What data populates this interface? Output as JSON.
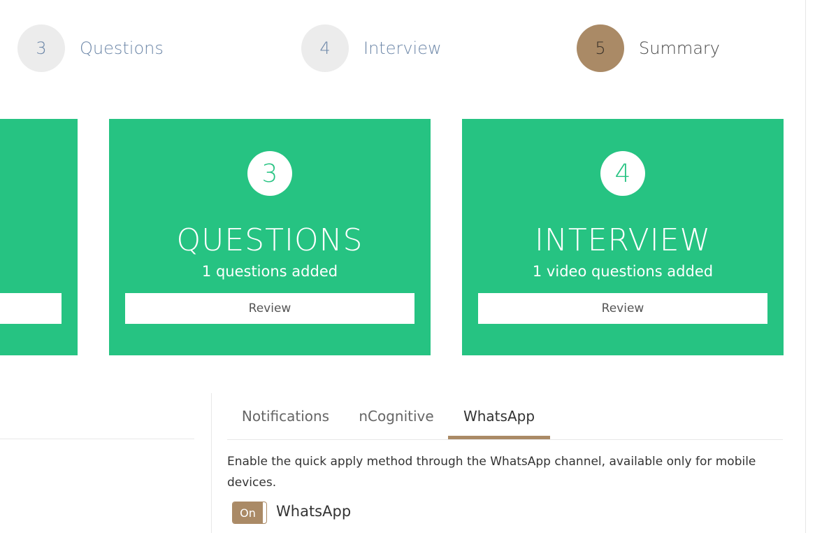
{
  "steps": [
    {
      "number": "3",
      "label": "Questions",
      "active": false
    },
    {
      "number": "4",
      "label": "Interview",
      "active": false
    },
    {
      "number": "5",
      "label": "Summary",
      "active": true
    }
  ],
  "cards": [
    {
      "number": "",
      "title": "",
      "subtitle": "",
      "button": ""
    },
    {
      "number": "3",
      "title": "QUESTIONS",
      "subtitle": "1 questions added",
      "button": "Review"
    },
    {
      "number": "4",
      "title": "INTERVIEW",
      "subtitle": "1 video questions added",
      "button": "Review"
    }
  ],
  "tabs": [
    {
      "label": "Notifications",
      "active": false
    },
    {
      "label": "nCognitive",
      "active": false
    },
    {
      "label": "WhatsApp",
      "active": true
    }
  ],
  "whatsapp": {
    "description": "Enable the quick apply method through the WhatsApp channel, available only for mobile devices.",
    "toggle_state": "On",
    "toggle_label": "WhatsApp"
  },
  "colors": {
    "accent": "#aa8a66",
    "card_green": "#26c382",
    "step_inactive_bg": "#ececec",
    "step_inactive_text": "#6d87a8"
  }
}
